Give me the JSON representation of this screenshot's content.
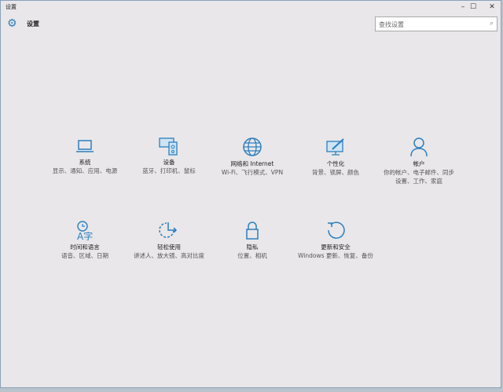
{
  "window": {
    "title": "设置",
    "minimize": "–",
    "maximize": "☐",
    "close": "✕"
  },
  "header": {
    "title": "设置",
    "search_placeholder": "查找设置"
  },
  "items": [
    {
      "title": "系统",
      "desc": "显示、通知、应用、电源"
    },
    {
      "title": "设备",
      "desc": "蓝牙、打印机、鼠标"
    },
    {
      "title": "网络和 Internet",
      "desc": "Wi-Fi、飞行模式、VPN"
    },
    {
      "title": "个性化",
      "desc": "背景、锁屏、颜色"
    },
    {
      "title": "帐户",
      "desc": "你的帐户、电子邮件、同步设置、工作、家庭"
    },
    {
      "title": "时间和语言",
      "desc": "语音、区域、日期"
    },
    {
      "title": "轻松使用",
      "desc": "讲述人、放大镜、高对比度"
    },
    {
      "title": "隐私",
      "desc": "位置、相机"
    },
    {
      "title": "更新和安全",
      "desc": "Windows 更新、恢复、备份"
    }
  ],
  "colors": {
    "accent": "#2a7fc0",
    "background": "#e9e7e9"
  }
}
